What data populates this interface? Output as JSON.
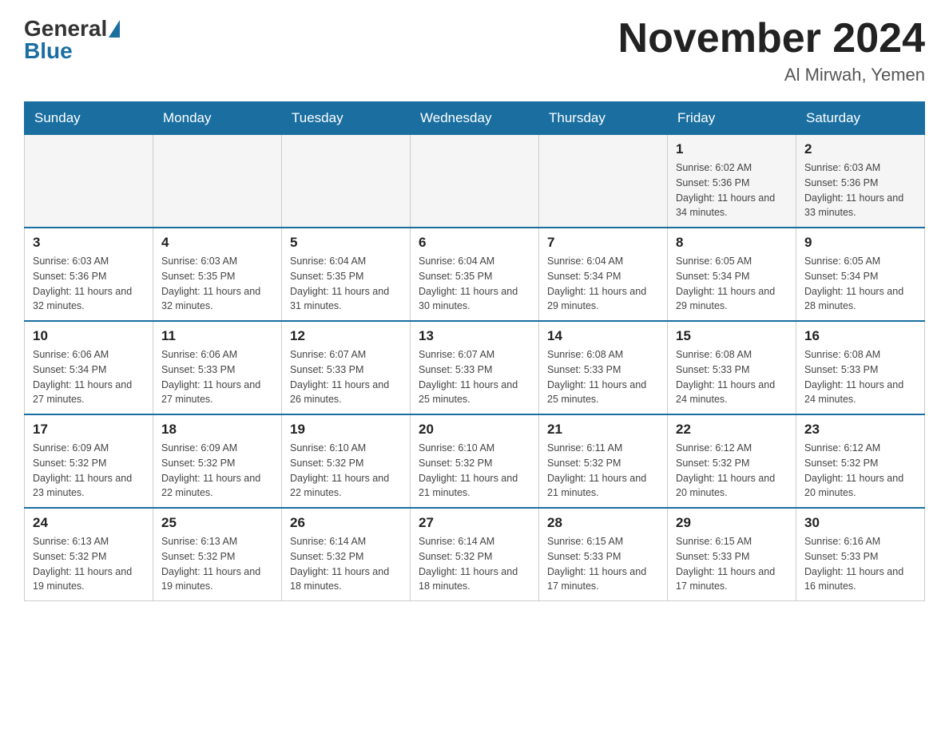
{
  "header": {
    "logo_general": "General",
    "logo_blue": "Blue",
    "month_title": "November 2024",
    "location": "Al Mirwah, Yemen"
  },
  "weekdays": [
    "Sunday",
    "Monday",
    "Tuesday",
    "Wednesday",
    "Thursday",
    "Friday",
    "Saturday"
  ],
  "weeks": [
    [
      {
        "day": "",
        "sunrise": "",
        "sunset": "",
        "daylight": ""
      },
      {
        "day": "",
        "sunrise": "",
        "sunset": "",
        "daylight": ""
      },
      {
        "day": "",
        "sunrise": "",
        "sunset": "",
        "daylight": ""
      },
      {
        "day": "",
        "sunrise": "",
        "sunset": "",
        "daylight": ""
      },
      {
        "day": "",
        "sunrise": "",
        "sunset": "",
        "daylight": ""
      },
      {
        "day": "1",
        "sunrise": "Sunrise: 6:02 AM",
        "sunset": "Sunset: 5:36 PM",
        "daylight": "Daylight: 11 hours and 34 minutes."
      },
      {
        "day": "2",
        "sunrise": "Sunrise: 6:03 AM",
        "sunset": "Sunset: 5:36 PM",
        "daylight": "Daylight: 11 hours and 33 minutes."
      }
    ],
    [
      {
        "day": "3",
        "sunrise": "Sunrise: 6:03 AM",
        "sunset": "Sunset: 5:36 PM",
        "daylight": "Daylight: 11 hours and 32 minutes."
      },
      {
        "day": "4",
        "sunrise": "Sunrise: 6:03 AM",
        "sunset": "Sunset: 5:35 PM",
        "daylight": "Daylight: 11 hours and 32 minutes."
      },
      {
        "day": "5",
        "sunrise": "Sunrise: 6:04 AM",
        "sunset": "Sunset: 5:35 PM",
        "daylight": "Daylight: 11 hours and 31 minutes."
      },
      {
        "day": "6",
        "sunrise": "Sunrise: 6:04 AM",
        "sunset": "Sunset: 5:35 PM",
        "daylight": "Daylight: 11 hours and 30 minutes."
      },
      {
        "day": "7",
        "sunrise": "Sunrise: 6:04 AM",
        "sunset": "Sunset: 5:34 PM",
        "daylight": "Daylight: 11 hours and 29 minutes."
      },
      {
        "day": "8",
        "sunrise": "Sunrise: 6:05 AM",
        "sunset": "Sunset: 5:34 PM",
        "daylight": "Daylight: 11 hours and 29 minutes."
      },
      {
        "day": "9",
        "sunrise": "Sunrise: 6:05 AM",
        "sunset": "Sunset: 5:34 PM",
        "daylight": "Daylight: 11 hours and 28 minutes."
      }
    ],
    [
      {
        "day": "10",
        "sunrise": "Sunrise: 6:06 AM",
        "sunset": "Sunset: 5:34 PM",
        "daylight": "Daylight: 11 hours and 27 minutes."
      },
      {
        "day": "11",
        "sunrise": "Sunrise: 6:06 AM",
        "sunset": "Sunset: 5:33 PM",
        "daylight": "Daylight: 11 hours and 27 minutes."
      },
      {
        "day": "12",
        "sunrise": "Sunrise: 6:07 AM",
        "sunset": "Sunset: 5:33 PM",
        "daylight": "Daylight: 11 hours and 26 minutes."
      },
      {
        "day": "13",
        "sunrise": "Sunrise: 6:07 AM",
        "sunset": "Sunset: 5:33 PM",
        "daylight": "Daylight: 11 hours and 25 minutes."
      },
      {
        "day": "14",
        "sunrise": "Sunrise: 6:08 AM",
        "sunset": "Sunset: 5:33 PM",
        "daylight": "Daylight: 11 hours and 25 minutes."
      },
      {
        "day": "15",
        "sunrise": "Sunrise: 6:08 AM",
        "sunset": "Sunset: 5:33 PM",
        "daylight": "Daylight: 11 hours and 24 minutes."
      },
      {
        "day": "16",
        "sunrise": "Sunrise: 6:08 AM",
        "sunset": "Sunset: 5:33 PM",
        "daylight": "Daylight: 11 hours and 24 minutes."
      }
    ],
    [
      {
        "day": "17",
        "sunrise": "Sunrise: 6:09 AM",
        "sunset": "Sunset: 5:32 PM",
        "daylight": "Daylight: 11 hours and 23 minutes."
      },
      {
        "day": "18",
        "sunrise": "Sunrise: 6:09 AM",
        "sunset": "Sunset: 5:32 PM",
        "daylight": "Daylight: 11 hours and 22 minutes."
      },
      {
        "day": "19",
        "sunrise": "Sunrise: 6:10 AM",
        "sunset": "Sunset: 5:32 PM",
        "daylight": "Daylight: 11 hours and 22 minutes."
      },
      {
        "day": "20",
        "sunrise": "Sunrise: 6:10 AM",
        "sunset": "Sunset: 5:32 PM",
        "daylight": "Daylight: 11 hours and 21 minutes."
      },
      {
        "day": "21",
        "sunrise": "Sunrise: 6:11 AM",
        "sunset": "Sunset: 5:32 PM",
        "daylight": "Daylight: 11 hours and 21 minutes."
      },
      {
        "day": "22",
        "sunrise": "Sunrise: 6:12 AM",
        "sunset": "Sunset: 5:32 PM",
        "daylight": "Daylight: 11 hours and 20 minutes."
      },
      {
        "day": "23",
        "sunrise": "Sunrise: 6:12 AM",
        "sunset": "Sunset: 5:32 PM",
        "daylight": "Daylight: 11 hours and 20 minutes."
      }
    ],
    [
      {
        "day": "24",
        "sunrise": "Sunrise: 6:13 AM",
        "sunset": "Sunset: 5:32 PM",
        "daylight": "Daylight: 11 hours and 19 minutes."
      },
      {
        "day": "25",
        "sunrise": "Sunrise: 6:13 AM",
        "sunset": "Sunset: 5:32 PM",
        "daylight": "Daylight: 11 hours and 19 minutes."
      },
      {
        "day": "26",
        "sunrise": "Sunrise: 6:14 AM",
        "sunset": "Sunset: 5:32 PM",
        "daylight": "Daylight: 11 hours and 18 minutes."
      },
      {
        "day": "27",
        "sunrise": "Sunrise: 6:14 AM",
        "sunset": "Sunset: 5:32 PM",
        "daylight": "Daylight: 11 hours and 18 minutes."
      },
      {
        "day": "28",
        "sunrise": "Sunrise: 6:15 AM",
        "sunset": "Sunset: 5:33 PM",
        "daylight": "Daylight: 11 hours and 17 minutes."
      },
      {
        "day": "29",
        "sunrise": "Sunrise: 6:15 AM",
        "sunset": "Sunset: 5:33 PM",
        "daylight": "Daylight: 11 hours and 17 minutes."
      },
      {
        "day": "30",
        "sunrise": "Sunrise: 6:16 AM",
        "sunset": "Sunset: 5:33 PM",
        "daylight": "Daylight: 11 hours and 16 minutes."
      }
    ]
  ]
}
